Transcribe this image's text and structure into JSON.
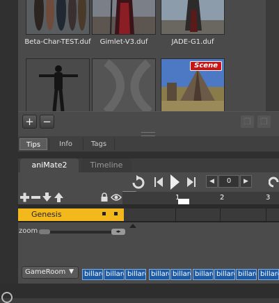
{
  "library": {
    "items": [
      {
        "caption": "Beta-Char-TEST.duf"
      },
      {
        "caption": "Gimlet-V3.duf"
      },
      {
        "caption": "JADE-G1.duf"
      },
      {
        "caption": ""
      },
      {
        "caption": ""
      },
      {
        "caption": "",
        "badge": "Scene"
      }
    ],
    "add_label": "+",
    "remove_label": "−"
  },
  "bottom_tabs": [
    "Tips",
    "Info",
    "Tags"
  ],
  "main_tabs": [
    "aniMate2",
    "Timeline"
  ],
  "transport": {
    "frame_value": "0"
  },
  "ruler": {
    "ticks": [
      "1",
      "2",
      "3"
    ]
  },
  "track": {
    "label": "Genesis"
  },
  "zoom_label": "zoom",
  "room_select": {
    "value": "GameRoom"
  },
  "aniblocks": [
    "billard",
    "billard",
    "billard",
    "billard",
    "billard",
    "billard",
    "billard",
    "billard",
    "billard"
  ],
  "colors": {
    "track": "#f2b81c",
    "aniblock": "#1d5aa6",
    "scene_badge": "#c81414"
  }
}
